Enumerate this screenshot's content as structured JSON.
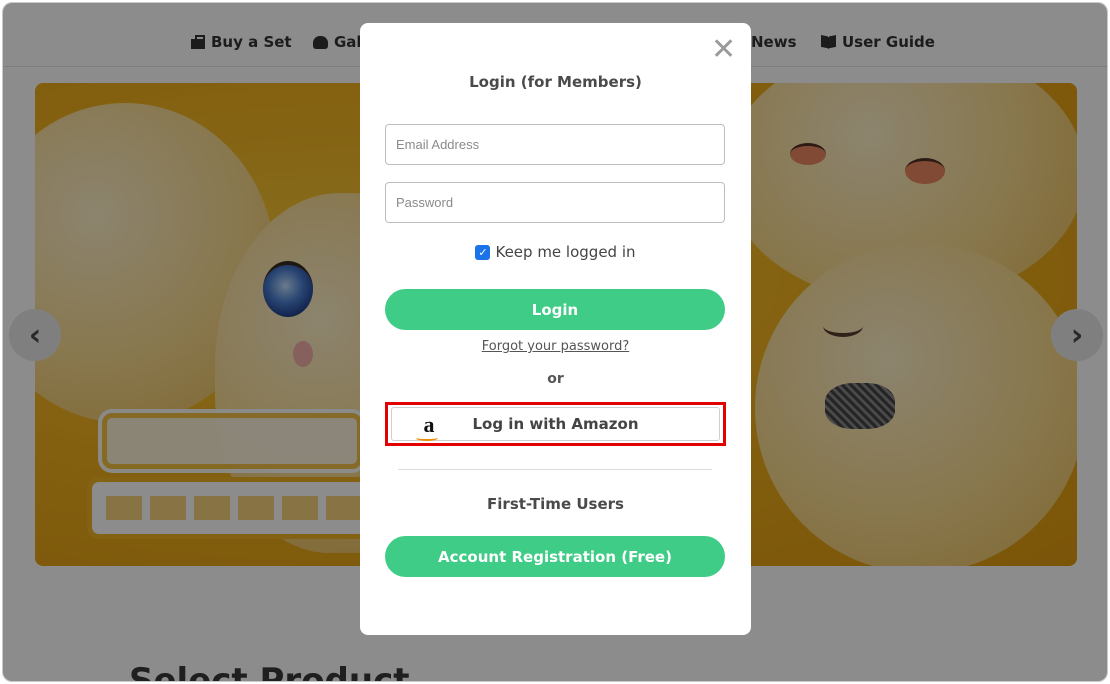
{
  "nav": {
    "items": [
      {
        "label": "Buy a Set",
        "icon": "set-icon"
      },
      {
        "label": "Gal",
        "icon": "gallery-icon"
      },
      {
        "label": "News",
        "icon": ""
      },
      {
        "label": "User Guide",
        "icon": "book-icon"
      }
    ]
  },
  "section": {
    "heading": "Select Product"
  },
  "modal": {
    "title": "Login (for Members)",
    "close_symbol": "✕",
    "email_placeholder": "Email Address",
    "password_placeholder": "Password",
    "remember_label": "Keep me logged in",
    "remember_checked": true,
    "login_button": "Login",
    "forgot_link": "Forgot your password?",
    "or_text": "or",
    "amazon_button": "Log in with Amazon",
    "amazon_logo_letter": "a",
    "first_time_label": "First-Time Users",
    "register_button": "Account Registration (Free)"
  },
  "colors": {
    "primary_green": "#3fcc86",
    "highlight_red": "#e20000",
    "checkbox_blue": "#1a73e8"
  }
}
